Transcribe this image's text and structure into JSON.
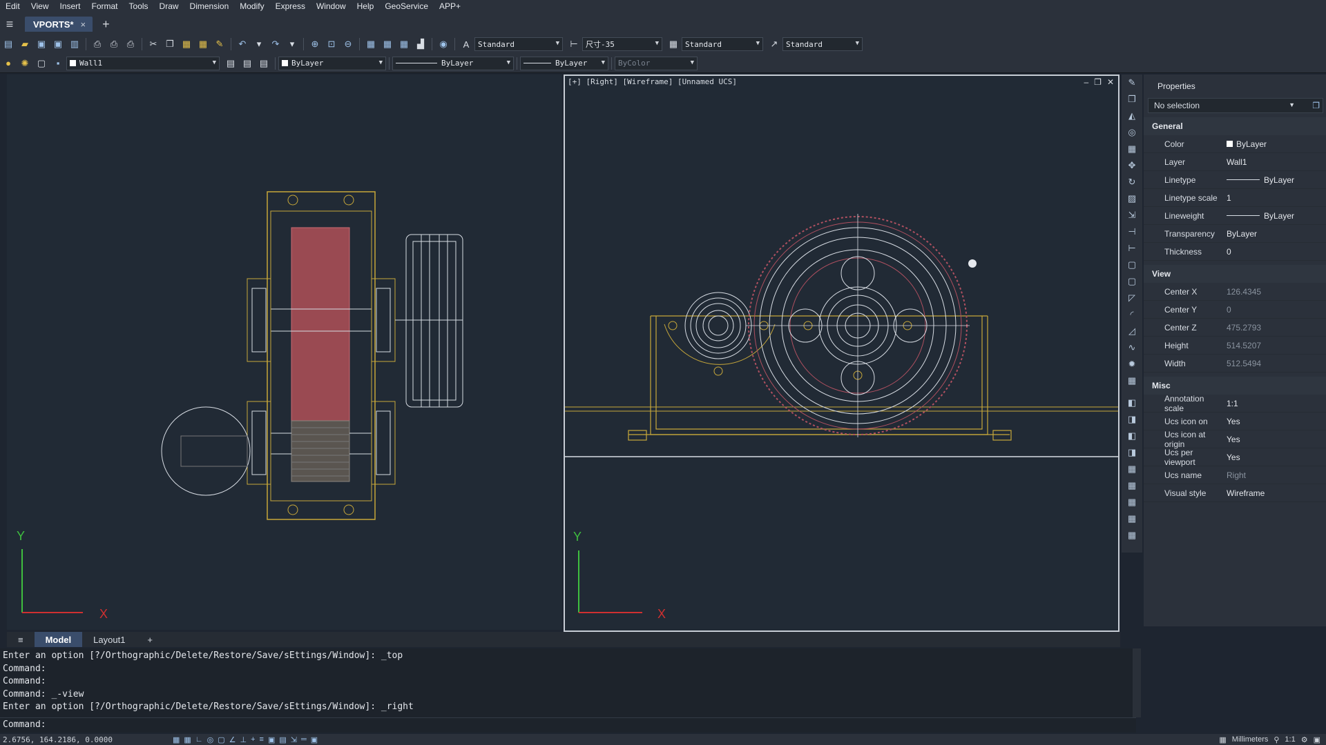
{
  "menu": [
    "Edit",
    "View",
    "Insert",
    "Format",
    "Tools",
    "Draw",
    "Dimension",
    "Modify",
    "Express",
    "Window",
    "Help",
    "GeoService",
    "APP+"
  ],
  "doc_tab": {
    "label": "VPORTS*",
    "close": "×"
  },
  "toolbar": {
    "text_style": "Standard",
    "dim_style": "尺寸-35",
    "table_style": "Standard",
    "mleader_style": "Standard"
  },
  "layer_bar": {
    "layer": "Wall1",
    "color": "ByLayer",
    "linetype": "ByLayer",
    "lineweight": "ByLayer",
    "plotstyle": "ByColor"
  },
  "viewport_right": {
    "label": "[+] [Right] [Wireframe] [Unnamed UCS]"
  },
  "axis": {
    "x": "X",
    "y": "Y"
  },
  "properties": {
    "title": "Properties",
    "selection": "No selection",
    "sections": [
      {
        "name": "General",
        "rows": [
          {
            "key": "Color",
            "value": "ByLayer"
          },
          {
            "key": "Layer",
            "value": "Wall1"
          },
          {
            "key": "Linetype",
            "value": "ByLayer"
          },
          {
            "key": "Linetype scale",
            "value": "1"
          },
          {
            "key": "Lineweight",
            "value": "ByLayer"
          },
          {
            "key": "Transparency",
            "value": "ByLayer"
          },
          {
            "key": "Thickness",
            "value": "0"
          }
        ]
      },
      {
        "name": "View",
        "rows": [
          {
            "key": "Center X",
            "value": "126.4345"
          },
          {
            "key": "Center Y",
            "value": "0"
          },
          {
            "key": "Center Z",
            "value": "475.2793"
          },
          {
            "key": "Height",
            "value": "514.5207"
          },
          {
            "key": "Width",
            "value": "512.5494"
          }
        ]
      },
      {
        "name": "Misc",
        "rows": [
          {
            "key": "Annotation scale",
            "value": "1:1"
          },
          {
            "key": "Ucs icon on",
            "value": "Yes"
          },
          {
            "key": "Ucs icon at origin",
            "value": "Yes"
          },
          {
            "key": "Ucs per viewport",
            "value": "Yes"
          },
          {
            "key": "Ucs name",
            "value": "Right"
          },
          {
            "key": "Visual style",
            "value": "Wireframe"
          }
        ]
      }
    ]
  },
  "layout_tabs": [
    "Model",
    "Layout1"
  ],
  "command_history": [
    "Enter an option [?/Orthographic/Delete/Restore/Save/sEttings/Window]: _top",
    "Command:",
    "Command:",
    "Command: _-view",
    "Enter an option [?/Orthographic/Delete/Restore/Save/sEttings/Window]: _right"
  ],
  "command_prompt": "Command:",
  "status": {
    "coords": "2.6756, 164.2186, 0.0000",
    "units": "Millimeters",
    "scale": "1:1"
  },
  "colors": {
    "accent": "#3a4d6b",
    "frame": "#c8a83a",
    "bearing": "#d8dde4",
    "gear": "#b05060"
  }
}
